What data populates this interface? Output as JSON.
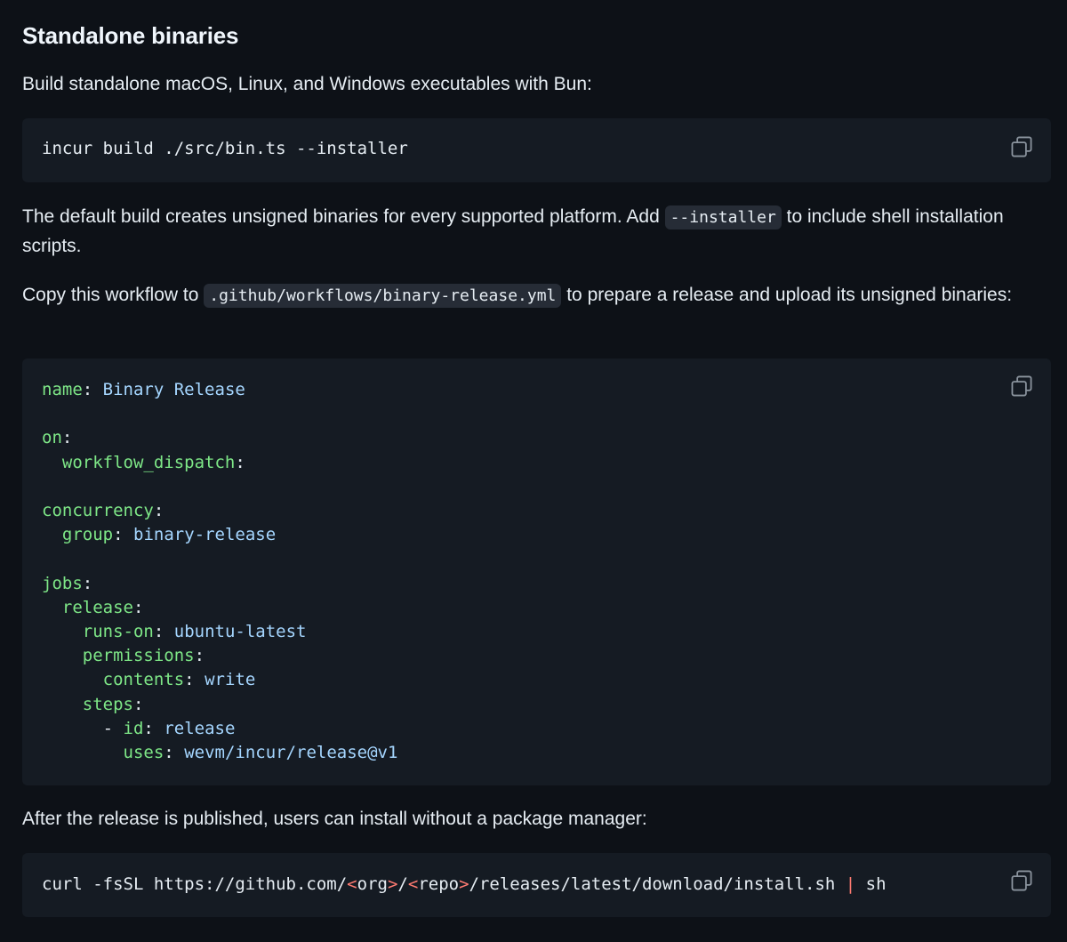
{
  "section": {
    "heading": "Standalone binaries",
    "intro": "Build standalone macOS, Linux, and Windows executables with Bun:"
  },
  "build_command": {
    "code": "incur build ./src/bin.ts --installer",
    "copy_icon": "copy-icon"
  },
  "default_build": {
    "text_before": "The default build creates unsigned binaries for every supported platform. Add ",
    "flag": "--installer",
    "text_after": " to include shell installation scripts."
  },
  "workflow_intro": {
    "text_before": "Copy this workflow to ",
    "path": ".github/workflows/binary-release.yml",
    "text_after": " to prepare a release and upload its unsigned binaries:"
  },
  "workflow_yaml": {
    "copy_icon": "copy-icon",
    "lines": [
      {
        "indent": "",
        "key": "name",
        "value": "Binary Release"
      },
      {
        "indent": "",
        "key": "",
        "value": ""
      },
      {
        "indent": "",
        "key": "on",
        "value": ""
      },
      {
        "indent": "  ",
        "key": "workflow_dispatch",
        "value": ""
      },
      {
        "indent": "",
        "key": "",
        "value": ""
      },
      {
        "indent": "",
        "key": "concurrency",
        "value": ""
      },
      {
        "indent": "  ",
        "key": "group",
        "value": "binary-release"
      },
      {
        "indent": "",
        "key": "",
        "value": ""
      },
      {
        "indent": "",
        "key": "jobs",
        "value": ""
      },
      {
        "indent": "  ",
        "key": "release",
        "value": ""
      },
      {
        "indent": "    ",
        "key": "runs-on",
        "value": "ubuntu-latest"
      },
      {
        "indent": "    ",
        "key": "permissions",
        "value": ""
      },
      {
        "indent": "      ",
        "key": "contents",
        "value": "write"
      },
      {
        "indent": "    ",
        "key": "steps",
        "value": ""
      },
      {
        "indent": "      - ",
        "key": "id",
        "value": "release"
      },
      {
        "indent": "        ",
        "key": "uses",
        "value": "wevm/incur/release@v1"
      }
    ]
  },
  "install_intro": {
    "text": "After the release is published, users can install without a package manager:"
  },
  "install_command": {
    "copy_icon": "copy-icon",
    "part1": "curl -fsSL https://github.com/",
    "lt1": "<",
    "org": "org",
    "gt1": ">",
    "slash": "/",
    "lt2": "<",
    "repo": "repo",
    "gt2": ">",
    "part2": "/releases/latest/download/install.sh ",
    "pipe": "|",
    "part3": " sh"
  },
  "colors": {
    "background": "#0d1117",
    "code_background": "#151b23",
    "yaml_key": "#7ee787",
    "yaml_value": "#a5d6ff",
    "operator": "#ff7b72"
  }
}
